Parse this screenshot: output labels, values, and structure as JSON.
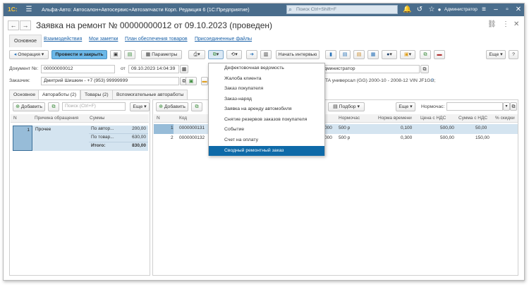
{
  "titlebar": {
    "logo": "1С:",
    "title": "Альфа-Авто: Автосалон+Автосервис+Автозапчасти Корп. Редакция 6  (1С:Предприятие)",
    "search_placeholder": "Поиск Ctrl+Shift+F",
    "user": "Администратор",
    "bg_color": "#4a6d8c"
  },
  "header": {
    "back_glyph": "←",
    "forward_glyph": "→",
    "star_glyph": "☆",
    "title": "Заявка на ремонт № 00000000012 от 09.10.2023 (проведен)",
    "link_glyph": "🔗",
    "more_glyph": "⋮",
    "close_glyph": "✕"
  },
  "sections": {
    "items": [
      "Основное",
      "Взаимодействия",
      "Мои заметки",
      "План обеспечения товаров",
      "Присоединенные файлы"
    ]
  },
  "toolbar": {
    "operation": "Операция",
    "post_close": "Провести и закрыть",
    "params": "Параметры",
    "start_interview": "Начать интервью",
    "more": "Еще"
  },
  "doc": {
    "number_label": "Документ №:",
    "number": "00000000012",
    "from_label": "от",
    "date": "09.10.2023 14:04:39",
    "customer_label": "Заказчик:",
    "customer": "Дмитрий Шишкин - +7 (953) 99999999",
    "manager": "дминистратор",
    "car": "TA универсал (GG) 2000-10 - 2008-12 VIN JF1GG;",
    "help": "?"
  },
  "doctabs": {
    "items": [
      "Основное",
      "Автоработы (2)",
      "Товары (2)",
      "Вспомогательные автоработы"
    ]
  },
  "left": {
    "add": "Добавить",
    "search_placeholder": "Поиск (Ctrl+F)",
    "more": "Еще",
    "columns": [
      "N",
      "Причина обращения",
      "Суммы"
    ],
    "row": {
      "n": "1",
      "reason": "Прочее"
    },
    "sums": [
      {
        "label": "По автор...",
        "value": "200,00"
      },
      {
        "label": "По товар...",
        "value": "630,00"
      },
      {
        "label": "Итого:",
        "value": "830,00"
      }
    ]
  },
  "right": {
    "add": "Добавить",
    "select": "Подбор",
    "more": "Еще",
    "normhour_label": "Нормочас:",
    "columns": [
      "N",
      "Код",
      "Нормочас",
      "Норма времени",
      "Цена с НДС",
      "Сумма с НДС",
      "% скидки"
    ],
    "rows": [
      {
        "n": "1",
        "code": "0000000131",
        "tail": "000",
        "normhour": "500 р",
        "norm_time": "0,100",
        "price": "500,00",
        "sum": "50,00"
      },
      {
        "n": "2",
        "code": "0000000132",
        "tail": "000",
        "normhour": "500 р",
        "norm_time": "0,300",
        "price": "500,00",
        "sum": "150,00"
      }
    ]
  },
  "print_menu": {
    "items": [
      "Дефектовочная ведомость",
      "Жалоба клиента",
      "Заказ покупателя",
      "Заказ-наряд",
      "Заявка на аренду автомобиля",
      "Снятие резервов заказов покупателя",
      "Событие",
      "Счет на оплату",
      "Сводный ремонтный заказ"
    ],
    "selected_index": 8,
    "selected_color": "#0e6aa8"
  }
}
